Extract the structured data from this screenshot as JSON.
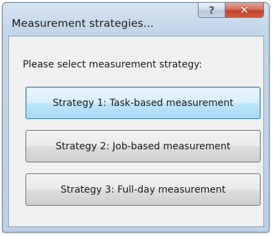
{
  "window": {
    "title": "Measurement strategies...",
    "help_glyph": "?",
    "close_glyph": "✕"
  },
  "dialog": {
    "prompt": "Please select measurement strategy:",
    "buttons": [
      {
        "label": "Strategy 1: Task-based measurement",
        "focused": true
      },
      {
        "label": "Strategy 2: Job-based measurement",
        "focused": false
      },
      {
        "label": "Strategy 3: Full-day measurement",
        "focused": false
      }
    ]
  },
  "colors": {
    "frame": "#c3d6ea",
    "client": "#f0f0f0",
    "close_button": "#c4402b",
    "focused_button": "#bee6fd"
  }
}
